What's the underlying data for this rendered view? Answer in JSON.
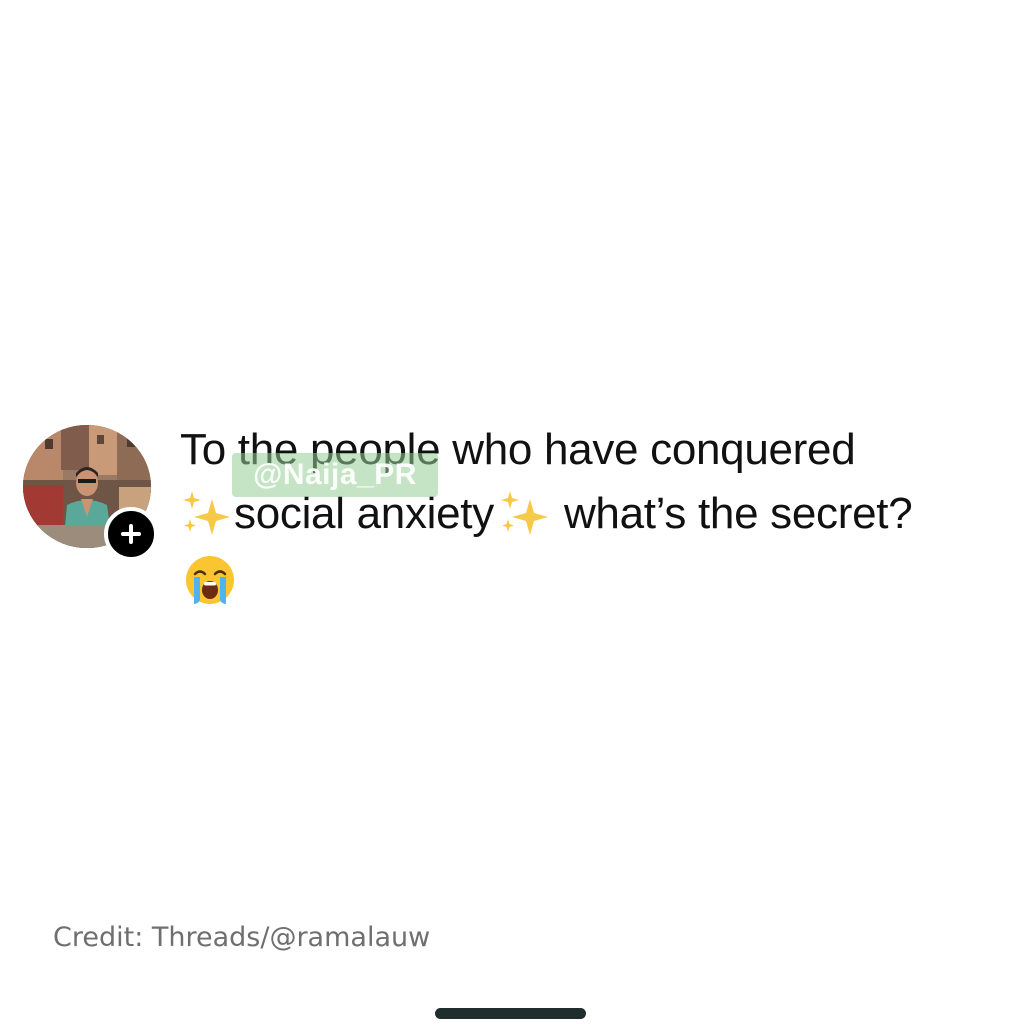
{
  "post": {
    "avatar_alt": "user avatar photo",
    "follow_icon": "plus-icon",
    "line1": "To the people who have conquered",
    "line2_text": "social anxiety",
    "line2_question": "what’s the secret?",
    "emojis": [
      "sparkles-emoji",
      "sparkles-emoji",
      "loudly-crying-face-emoji"
    ]
  },
  "watermark": {
    "text": "@Naija_PR"
  },
  "credit": {
    "text": "Credit: Threads/@ramalauw"
  },
  "colors": {
    "background": "#ffffff",
    "text": "#111111",
    "credit_text": "#6f6f6f",
    "follow_button": "#000000",
    "watermark_bg": "#96cd96",
    "home_indicator": "#1f2d2d"
  }
}
